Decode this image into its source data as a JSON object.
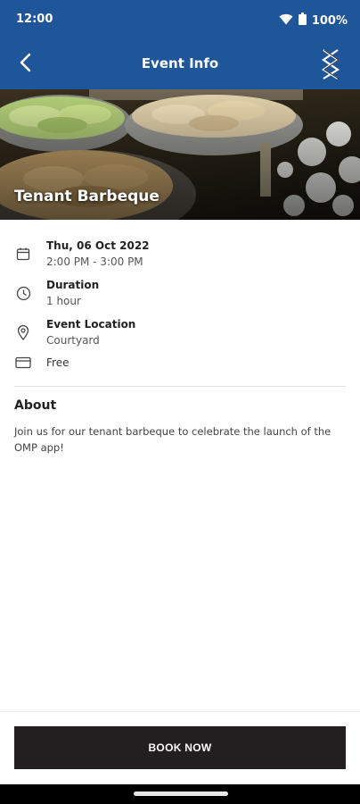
{
  "status_bar": {
    "time": "12:00",
    "battery": "100%",
    "icons": [
      "wifi-icon",
      "battery-icon"
    ]
  },
  "app_bar": {
    "title": "Event Info",
    "back_icon": "arrow-left-icon",
    "logo": "brand-logo-icon"
  },
  "event": {
    "title": "Tenant Barbeque",
    "date": "Thu, 06 Oct 2022",
    "time_range": "2:00 PM - 3:00 PM",
    "duration_label": "Duration",
    "duration_value": "1 hour",
    "location_label": "Event Location",
    "location_value": "Courtyard",
    "price": "Free"
  },
  "about": {
    "heading": "About",
    "text": "Join us for our tenant barbeque to celebrate the launch of the OMP app!"
  },
  "actions": {
    "book_label": "BOOK NOW"
  },
  "colors": {
    "header": "#1f5599",
    "button": "#231f20"
  }
}
